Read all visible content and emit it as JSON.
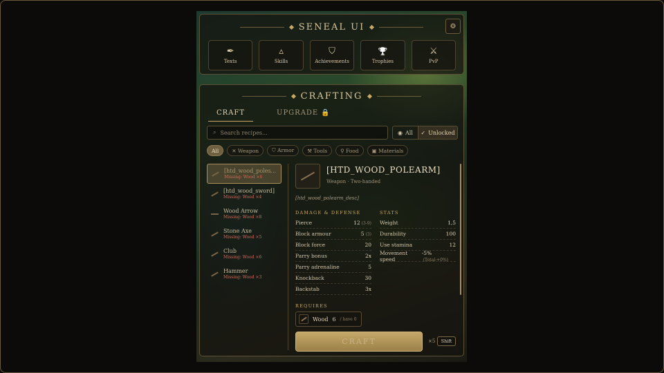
{
  "header": {
    "title": "SENEAL UI",
    "settings_icon": "gear-icon"
  },
  "nav": [
    {
      "label": "Texts",
      "icon": "quill-icon",
      "glyph": "✒"
    },
    {
      "label": "Skills",
      "icon": "triangle-icon",
      "glyph": "▵"
    },
    {
      "label": "Achievements",
      "icon": "shield-icon",
      "glyph": "⛉"
    },
    {
      "label": "Trophies",
      "icon": "trophy-icon",
      "glyph": "🏆"
    },
    {
      "label": "PvP",
      "icon": "crossed-swords-icon",
      "glyph": "⚔"
    }
  ],
  "crafting": {
    "title": "CRAFTING",
    "tabs": [
      {
        "label": "CRAFT",
        "active": true
      },
      {
        "label": "UPGRADE 🔒",
        "active": false
      }
    ],
    "search_placeholder": "Search recipes...",
    "filter": {
      "all": "All",
      "unlocked": "Unlocked"
    },
    "chips": [
      {
        "label": "All",
        "active": true
      },
      {
        "label": "✕ Weapon"
      },
      {
        "label": "⛉ Armor"
      },
      {
        "label": "⚒ Tools"
      },
      {
        "label": "⚲ Food"
      },
      {
        "label": "▣ Materials"
      }
    ],
    "recipes": [
      {
        "name": "[htd_wood_poles...",
        "missing": "Missing: Wood ×6",
        "selected": true
      },
      {
        "name": "[htd_wood_sword]",
        "missing": "Missing: Wood ×4"
      },
      {
        "name": "Wood Arrow",
        "missing": "Missing: Wood ×8"
      },
      {
        "name": "Stone Axe",
        "missing": "Missing: Wood ×5"
      },
      {
        "name": "Club",
        "missing": "Missing: Wood ×6"
      },
      {
        "name": "Hammer",
        "missing": "Missing: Wood ×3"
      }
    ],
    "detail": {
      "title": "[HTD_WOOD_POLEARM]",
      "subtitle": "Weapon · Two-handed",
      "description": "[htd_wood_polearm_desc]",
      "damage_title": "DAMAGE & DEFENSE",
      "stats_title": "STATS",
      "damage": [
        {
          "label": "Pierce",
          "value": "12",
          "extra": "(3-9)"
        },
        {
          "label": "Block armour",
          "value": "5",
          "extra": "(3)"
        },
        {
          "label": "Block force",
          "value": "20",
          "extra": ""
        },
        {
          "label": "Parry bonus",
          "value": "2x",
          "extra": ""
        },
        {
          "label": "Parry adrenaline",
          "value": "5",
          "extra": ""
        },
        {
          "label": "Knockback",
          "value": "30",
          "extra": ""
        },
        {
          "label": "Backstab",
          "value": "3x",
          "extra": ""
        }
      ],
      "stats": [
        {
          "label": "Weight",
          "value": "1,5",
          "extra": ""
        },
        {
          "label": "Durability",
          "value": "100",
          "extra": ""
        },
        {
          "label": "Use stamina",
          "value": "12",
          "extra": ""
        },
        {
          "label": "Movement speed",
          "value": "-5%",
          "extra": "(Total:+0%)"
        }
      ],
      "requires_title": "REQUIRES",
      "requirement": {
        "name": "Wood",
        "amount": "6",
        "have": "/ have 0"
      },
      "craft_label": "CRAFT",
      "multiplier": "×5",
      "shift_label": "Shift"
    }
  }
}
